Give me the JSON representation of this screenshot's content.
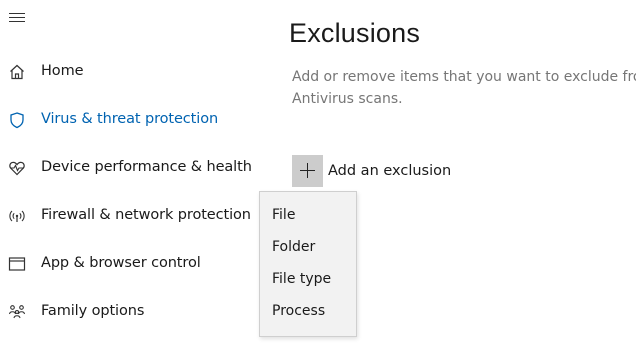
{
  "nav": {
    "items": [
      {
        "label": "Home",
        "icon": "home-icon"
      },
      {
        "label": "Virus & threat protection",
        "icon": "shield-icon",
        "active": true
      },
      {
        "label": "Device performance & health",
        "icon": "heart-icon"
      },
      {
        "label": "Firewall & network protection",
        "icon": "wifi-icon"
      },
      {
        "label": "App & browser control",
        "icon": "browser-window-icon"
      },
      {
        "label": "Family options",
        "icon": "family-icon"
      }
    ]
  },
  "main": {
    "title": "Exclusions",
    "description_line1": "Add or remove items that you want to exclude from",
    "description_line2": "Antivirus scans.",
    "add_exclusion_label": "Add an exclusion"
  },
  "dropdown": {
    "options": [
      "File",
      "Folder",
      "File type",
      "Process"
    ]
  },
  "colors": {
    "accent": "#0063b1",
    "plus_box": "#cccccc",
    "dropdown_bg": "#f2f2f2",
    "description_text": "#767676"
  }
}
